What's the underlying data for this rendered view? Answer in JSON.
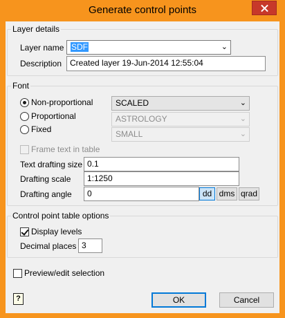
{
  "window": {
    "title": "Generate control points"
  },
  "layer_details": {
    "legend": "Layer details",
    "layer_name_label": "Layer name",
    "layer_name_value": "SDF",
    "description_label": "Description",
    "description_value": "Created layer 19-Jun-2014 12:55:04"
  },
  "font": {
    "legend": "Font",
    "options": [
      {
        "label": "Non-proportional",
        "selected": true,
        "combo": "SCALED"
      },
      {
        "label": "Proportional",
        "selected": false,
        "combo": "ASTROLOGY"
      },
      {
        "label": "Fixed",
        "selected": false,
        "combo": "SMALL"
      }
    ],
    "frame_text_label": "Frame text in table",
    "frame_text_checked": false,
    "text_drafting_size_label": "Text drafting size",
    "text_drafting_size_value": "0.1",
    "drafting_scale_label": "Drafting scale",
    "drafting_scale_value": "1:1250",
    "drafting_angle_label": "Drafting angle",
    "drafting_angle_value": "0",
    "angle_units": [
      "dd",
      "dms",
      "qrad"
    ],
    "active_angle_unit": "dd"
  },
  "control_point_table": {
    "legend": "Control point table options",
    "display_levels_label": "Display levels",
    "display_levels_checked": true,
    "decimal_places_label": "Decimal places",
    "decimal_places_value": "3"
  },
  "preview_label": "Preview/edit selection",
  "preview_checked": false,
  "help_icon_glyph": "?",
  "buttons": {
    "ok": "OK",
    "cancel": "Cancel"
  },
  "colors": {
    "title_bar": "#f7941d",
    "close_button": "#c7382a",
    "selection": "#3399ff",
    "default_button_border": "#0078d7"
  }
}
